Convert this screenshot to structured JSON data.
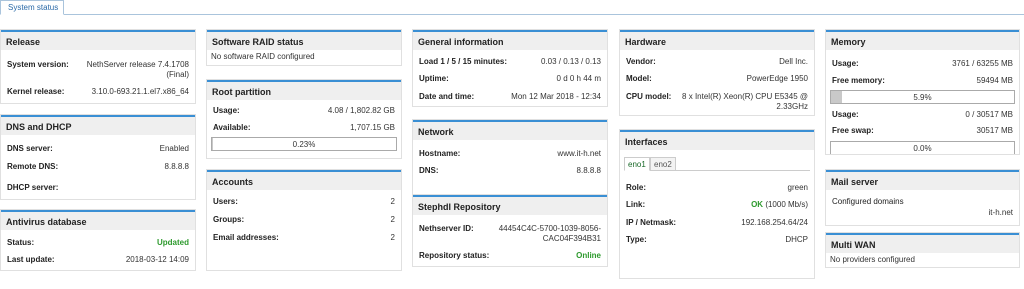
{
  "tabs": {
    "system_status": "System status"
  },
  "release": {
    "title": "Release",
    "system_version_label": "System version:",
    "system_version_line1": "NethServer release 7.4.1708",
    "system_version_line2": "(Final)",
    "kernel_label": "Kernel release:",
    "kernel_value": "3.10.0-693.21.1.el7.x86_64"
  },
  "dns": {
    "title": "DNS and DHCP",
    "dns_server_label": "DNS server:",
    "dns_server_value": "Enabled",
    "remote_dns_label": "Remote DNS:",
    "remote_dns_value": "8.8.8.8",
    "dhcp_label": "DHCP server:"
  },
  "antivirus": {
    "title": "Antivirus database",
    "status_label": "Status:",
    "status_value": "Updated",
    "last_update_label": "Last update:",
    "last_update_value": "2018-03-12 14:09"
  },
  "raid": {
    "title": "Software RAID status",
    "message": "No software RAID configured"
  },
  "root": {
    "title": "Root partition",
    "usage_label": "Usage:",
    "usage_value": "4.08 / 1,802.82 GB",
    "available_label": "Available:",
    "available_value": "1,707.15 GB",
    "bar_text": "0.23%",
    "bar_fraction": 0.0023
  },
  "accounts": {
    "title": "Accounts",
    "users_label": "Users:",
    "users_value": "2",
    "groups_label": "Groups:",
    "groups_value": "2",
    "email_label": "Email addresses:",
    "email_value": "2"
  },
  "general": {
    "title": "General information",
    "load_label": "Load 1 / 5 / 15 minutes:",
    "load_value": "0.03 / 0.13 / 0.13",
    "uptime_label": "Uptime:",
    "uptime_value": "0 d 0 h 44 m",
    "datetime_label": "Date and time:",
    "datetime_value": "Mon 12 Mar 2018 - 12:34"
  },
  "network": {
    "title": "Network",
    "hostname_label": "Hostname:",
    "hostname_value": "www.it-h.net",
    "dns_label": "DNS:",
    "dns_value": "8.8.8.8"
  },
  "repo": {
    "title": "Stephdl Repository",
    "id_label": "Nethserver ID:",
    "id_line1": "44454C4C-5700-1039-8056-",
    "id_line2": "CAC04F394B31",
    "status_label": "Repository status:",
    "status_value": "Online"
  },
  "hardware": {
    "title": "Hardware",
    "vendor_label": "Vendor:",
    "vendor_value": "Dell Inc.",
    "model_label": "Model:",
    "model_value": "PowerEdge 1950",
    "cpu_label": "CPU model:",
    "cpu_line1": "8 x Intel(R) Xeon(R) CPU E5345 @",
    "cpu_line2": "2.33GHz"
  },
  "interfaces": {
    "title": "Interfaces",
    "tabs": [
      "eno1",
      "eno2"
    ],
    "role_label": "Role:",
    "role_value": "green",
    "link_label": "Link:",
    "link_ok": "OK",
    "link_speed": "(1000 Mb/s)",
    "ip_label": "IP / Netmask:",
    "ip_value": "192.168.254.64/24",
    "type_label": "Type:",
    "type_value": "DHCP"
  },
  "memory": {
    "title": "Memory",
    "usage_label": "Usage:",
    "usage_value": "3761 / 63255 MB",
    "free_label": "Free memory:",
    "free_value": "59494 MB",
    "mem_bar_text": "5.9%",
    "mem_bar_fraction": 0.059,
    "swap_usage_label": "Usage:",
    "swap_usage_value": "0 / 30517 MB",
    "free_swap_label": "Free swap:",
    "free_swap_value": "30517 MB",
    "swap_bar_text": "0.0%",
    "swap_bar_fraction": 0.0
  },
  "mail": {
    "title": "Mail server",
    "domains_label": "Configured domains",
    "domains_value": "it-h.net"
  },
  "multiwan": {
    "title": "Multi WAN",
    "message": "No providers configured"
  }
}
